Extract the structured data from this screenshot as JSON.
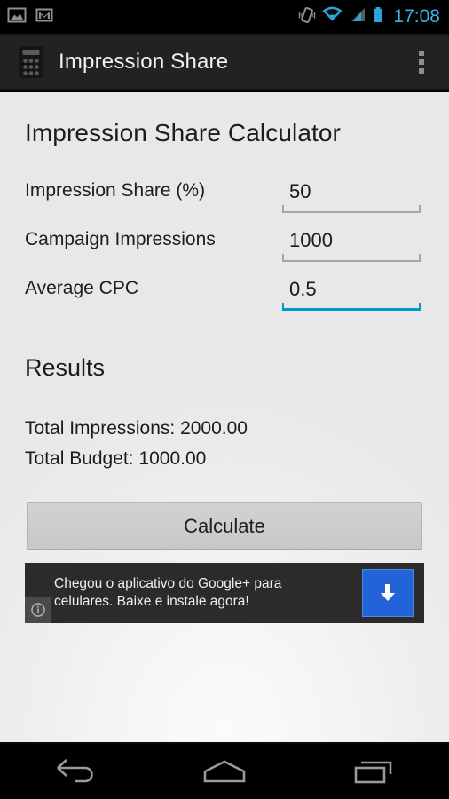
{
  "status_bar": {
    "left_icons": [
      {
        "name": "gallery-photo-icon",
        "label": "Photo"
      },
      {
        "name": "gmail-icon",
        "label": "Gmail"
      }
    ],
    "right_icons": [
      {
        "name": "vibrate-icon",
        "label": "Vibrate"
      },
      {
        "name": "wifi-icon",
        "label": "Wi-Fi"
      },
      {
        "name": "cell-signal-icon",
        "label": "Signal"
      },
      {
        "name": "battery-icon",
        "label": "Battery"
      }
    ],
    "clock": "17:08",
    "accent": "#3ab0e2",
    "background": "#000000"
  },
  "action_bar": {
    "app_icon": "calculator-icon",
    "title": "Impression Share",
    "overflow_label": "More options",
    "background": "#222222",
    "title_color": "#f2f2f2"
  },
  "screen": {
    "page_title": "Impression Share Calculator",
    "background": "#ebebeb"
  },
  "form": {
    "fields": [
      {
        "label": "Impression Share (%)",
        "value": "50",
        "placeholder": "",
        "focused": false
      },
      {
        "label": "Campaign Impressions",
        "value": "1000",
        "placeholder": "",
        "focused": false
      },
      {
        "label": "Average CPC",
        "value": "0.5",
        "placeholder": "",
        "focused": true
      }
    ],
    "underline_color": "#a6a6a6",
    "focus_color": "#0099cc"
  },
  "results": {
    "heading": "Results",
    "lines": [
      "Total Impressions: 2000.00",
      "Total Budget: 1000.00"
    ]
  },
  "actions": {
    "calculate_label": "Calculate"
  },
  "ad": {
    "text_line1": "Chegou o aplicativo do Google+ para",
    "text_line2": "celulares. Baixe e instale agora!",
    "info_icon": "info-icon",
    "cta_icon": "download-arrow-icon",
    "cta_color": "#2264d8",
    "background": "#2b2b2b"
  },
  "nav_bar": {
    "buttons": [
      {
        "name": "back-button",
        "label": "Back"
      },
      {
        "name": "home-button",
        "label": "Home"
      },
      {
        "name": "recents-button",
        "label": "Recent apps"
      }
    ],
    "icon_color": "#9a9a9a"
  }
}
